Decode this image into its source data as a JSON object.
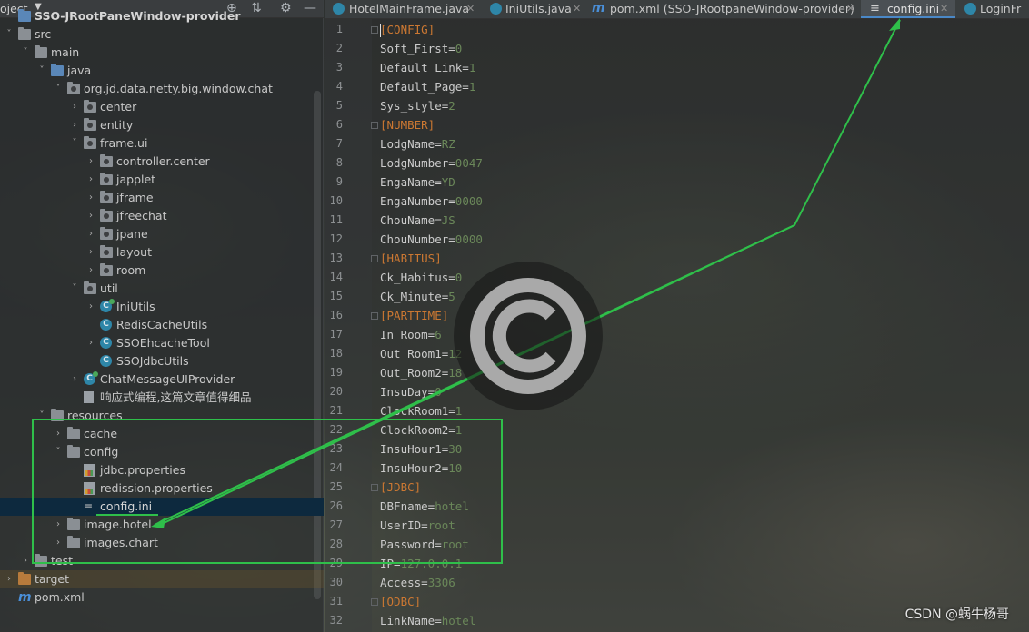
{
  "project_panel": {
    "title": "oject",
    "icons": [
      "crosshair-icon",
      "collapse-all-icon",
      "gear-icon",
      "minimize-icon"
    ]
  },
  "tree": [
    {
      "label": "SSO-JRootPaneWindow-provider",
      "icon": "module-folder",
      "depth": 0,
      "arrow": ""
    },
    {
      "label": "src",
      "icon": "folder",
      "depth": 0,
      "arrow": "down"
    },
    {
      "label": "main",
      "icon": "folder",
      "depth": 1,
      "arrow": "down"
    },
    {
      "label": "java",
      "icon": "folder-blue",
      "depth": 2,
      "arrow": "down"
    },
    {
      "label": "org.jd.data.netty.big.window.chat",
      "icon": "package",
      "depth": 3,
      "arrow": "down"
    },
    {
      "label": "center",
      "icon": "package",
      "depth": 4,
      "arrow": "right"
    },
    {
      "label": "entity",
      "icon": "package",
      "depth": 4,
      "arrow": "right"
    },
    {
      "label": "frame.ui",
      "icon": "package",
      "depth": 4,
      "arrow": "down"
    },
    {
      "label": "controller.center",
      "icon": "package",
      "depth": 5,
      "arrow": "right"
    },
    {
      "label": "japplet",
      "icon": "package",
      "depth": 5,
      "arrow": "right"
    },
    {
      "label": "jframe",
      "icon": "package",
      "depth": 5,
      "arrow": "right"
    },
    {
      "label": "jfreechat",
      "icon": "package",
      "depth": 5,
      "arrow": "right"
    },
    {
      "label": "jpane",
      "icon": "package",
      "depth": 5,
      "arrow": "right"
    },
    {
      "label": "layout",
      "icon": "package",
      "depth": 5,
      "arrow": "right"
    },
    {
      "label": "room",
      "icon": "package",
      "depth": 5,
      "arrow": "right"
    },
    {
      "label": "util",
      "icon": "package",
      "depth": 4,
      "arrow": "down"
    },
    {
      "label": "IniUtils",
      "icon": "class-runnable",
      "depth": 5,
      "arrow": "right"
    },
    {
      "label": "RedisCacheUtils",
      "icon": "class",
      "depth": 5,
      "arrow": ""
    },
    {
      "label": "SSOEhcacheTool",
      "icon": "class",
      "depth": 5,
      "arrow": "right"
    },
    {
      "label": "SSOJdbcUtils",
      "icon": "class",
      "depth": 5,
      "arrow": ""
    },
    {
      "label": "ChatMessageUIProvider",
      "icon": "class-runnable",
      "depth": 4,
      "arrow": "right"
    },
    {
      "label": "响应式编程,这篇文章值得细品",
      "icon": "file",
      "depth": 4,
      "arrow": ""
    },
    {
      "label": "resources",
      "icon": "folder-res",
      "depth": 2,
      "arrow": "down"
    },
    {
      "label": "cache",
      "icon": "folder",
      "depth": 3,
      "arrow": "right"
    },
    {
      "label": "config",
      "icon": "folder",
      "depth": 3,
      "arrow": "down"
    },
    {
      "label": "jdbc.properties",
      "icon": "properties",
      "depth": 4,
      "arrow": ""
    },
    {
      "label": "redission.properties",
      "icon": "properties",
      "depth": 4,
      "arrow": ""
    },
    {
      "label": "config.ini",
      "icon": "ini",
      "depth": 4,
      "arrow": "",
      "selected": true
    },
    {
      "label": "image.hotel",
      "icon": "folder",
      "depth": 3,
      "arrow": "right"
    },
    {
      "label": "images.chart",
      "icon": "folder",
      "depth": 3,
      "arrow": "right"
    },
    {
      "label": "test",
      "icon": "folder",
      "depth": 1,
      "arrow": "right"
    },
    {
      "label": "target",
      "icon": "folder-orange",
      "depth": 0,
      "arrow": "right",
      "highlight": true
    },
    {
      "label": "pom.xml",
      "icon": "maven",
      "depth": 0,
      "arrow": ""
    }
  ],
  "tabs": [
    {
      "label": "HotelMainFrame.java",
      "icon": "class-icon"
    },
    {
      "label": "IniUtils.java",
      "icon": "class-icon"
    },
    {
      "label": "pom.xml (SSO-JRootpaneWindow-provider)",
      "icon": "maven-icon"
    },
    {
      "label": "config.ini",
      "icon": "ini-icon",
      "active": true
    },
    {
      "label": "LoginFr",
      "icon": "class-icon"
    }
  ],
  "code_lines": [
    {
      "section": "[CONFIG]"
    },
    {
      "key": "Soft_First",
      "value": "0"
    },
    {
      "key": "Default_Link",
      "value": "1"
    },
    {
      "key": "Default_Page",
      "value": "1"
    },
    {
      "key": "Sys_style",
      "value": "2"
    },
    {
      "section": "[NUMBER]"
    },
    {
      "key": "LodgName",
      "value": "RZ"
    },
    {
      "key": "LodgNumber",
      "value": "0047"
    },
    {
      "key": "EngaName",
      "value": "YD"
    },
    {
      "key": "EngaNumber",
      "value": "0000"
    },
    {
      "key": "ChouName",
      "value": "JS"
    },
    {
      "key": "ChouNumber",
      "value": "0000"
    },
    {
      "section": "[HABITUS]"
    },
    {
      "key": "Ck_Habitus",
      "value": "0"
    },
    {
      "key": "Ck_Minute",
      "value": "5"
    },
    {
      "section": "[PARTTIME]"
    },
    {
      "key": "In_Room",
      "value": "6"
    },
    {
      "key": "Out_Room1",
      "value": "12"
    },
    {
      "key": "Out_Room2",
      "value": "18"
    },
    {
      "key": "InsuDay",
      "value": "0"
    },
    {
      "key": "ClockRoom1",
      "value": "1"
    },
    {
      "key": "ClockRoom2",
      "value": "1"
    },
    {
      "key": "InsuHour1",
      "value": "30"
    },
    {
      "key": "InsuHour2",
      "value": "10"
    },
    {
      "section": "[JDBC]"
    },
    {
      "key": "DBFname",
      "value": "hotel"
    },
    {
      "key": "UserID",
      "value": "root"
    },
    {
      "key": "Password",
      "value": "root"
    },
    {
      "key": "IP",
      "value": "127.0.0.1"
    },
    {
      "key": "Access",
      "value": "3306"
    },
    {
      "section": "[ODBC]"
    },
    {
      "key": "LinkName",
      "value": "hotel"
    }
  ],
  "watermark": {
    "icon": "copyright-icon"
  },
  "credit": "CSDN @蜗牛杨哥",
  "colors": {
    "section": "#cc7832",
    "value": "#6a8759",
    "annotation": "#2fbf4a",
    "selection": "#0d293e",
    "active_tab": "#4a88c7"
  }
}
